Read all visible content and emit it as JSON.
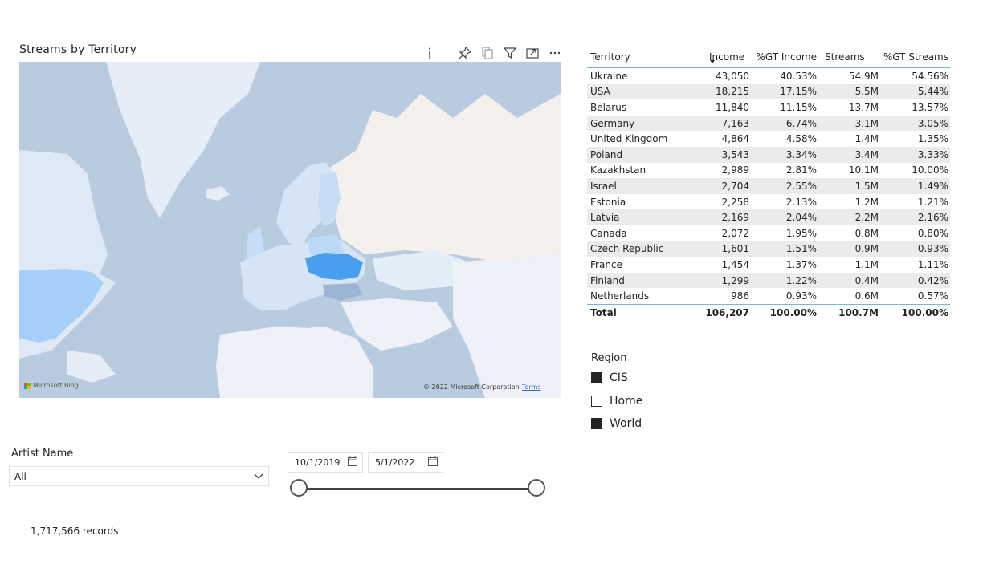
{
  "map": {
    "title": "Streams by Territory",
    "logo_text": "Microsoft Bing",
    "copyright": "© 2022 Microsoft Corporation",
    "terms_link": "Terms",
    "tools": [
      "info-icon",
      "pin-icon",
      "copy-icon",
      "filter-icon",
      "focus-mode-icon",
      "more-options-icon"
    ],
    "highlight_color": "#4a9ef0",
    "territory_fill": "#a6cffa"
  },
  "table": {
    "columns": [
      "Territory",
      "Income",
      "%GT Income",
      "Streams",
      "%GT Streams"
    ],
    "rows": [
      [
        "Ukraine",
        "43,050",
        "40.53%",
        "54.9M",
        "54.56%"
      ],
      [
        "USA",
        "18,215",
        "17.15%",
        "5.5M",
        "5.44%"
      ],
      [
        "Belarus",
        "11,840",
        "11.15%",
        "13.7M",
        "13.57%"
      ],
      [
        "Germany",
        "7,163",
        "6.74%",
        "3.1M",
        "3.05%"
      ],
      [
        "United Kingdom",
        "4,864",
        "4.58%",
        "1.4M",
        "1.35%"
      ],
      [
        "Poland",
        "3,543",
        "3.34%",
        "3.4M",
        "3.33%"
      ],
      [
        "Kazakhstan",
        "2,989",
        "2.81%",
        "10.1M",
        "10.00%"
      ],
      [
        "Israel",
        "2,704",
        "2.55%",
        "1.5M",
        "1.49%"
      ],
      [
        "Estonia",
        "2,258",
        "2.13%",
        "1.2M",
        "1.21%"
      ],
      [
        "Latvia",
        "2,169",
        "2.04%",
        "2.2M",
        "2.16%"
      ],
      [
        "Canada",
        "2,072",
        "1.95%",
        "0.8M",
        "0.80%"
      ],
      [
        "Czech Republic",
        "1,601",
        "1.51%",
        "0.9M",
        "0.93%"
      ],
      [
        "France",
        "1,454",
        "1.37%",
        "1.1M",
        "1.11%"
      ],
      [
        "Finland",
        "1,299",
        "1.22%",
        "0.4M",
        "0.42%"
      ],
      [
        "Netherlands",
        "986",
        "0.93%",
        "0.6M",
        "0.57%"
      ]
    ],
    "total": [
      "Total",
      "106,207",
      "100.00%",
      "100.7M",
      "100.00%"
    ]
  },
  "region": {
    "title": "Region",
    "items": [
      {
        "label": "CIS",
        "checked": true
      },
      {
        "label": "Home",
        "checked": false
      },
      {
        "label": "World",
        "checked": true
      }
    ]
  },
  "artist": {
    "title": "Artist Name",
    "value": "All"
  },
  "date": {
    "start": "10/1/2019",
    "end": "5/1/2022"
  },
  "records": "1,717,566 records"
}
